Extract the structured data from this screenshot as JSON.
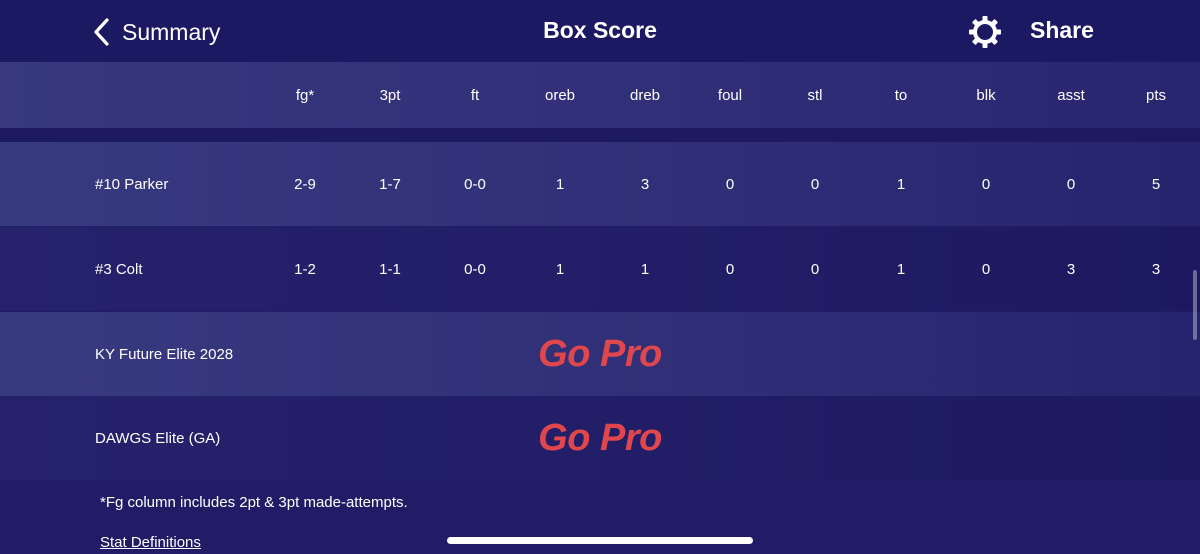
{
  "nav": {
    "back_label": "Summary",
    "title": "Box Score",
    "share_label": "Share"
  },
  "columns": [
    "fg*",
    "3pt",
    "ft",
    "oreb",
    "dreb",
    "foul",
    "stl",
    "to",
    "blk",
    "asst",
    "pts"
  ],
  "players": [
    {
      "name": "#10 Parker",
      "stats": [
        "2-9",
        "1-7",
        "0-0",
        "1",
        "3",
        "0",
        "0",
        "1",
        "0",
        "0",
        "5"
      ]
    },
    {
      "name": "#3 Colt",
      "stats": [
        "1-2",
        "1-1",
        "0-0",
        "1",
        "1",
        "0",
        "0",
        "1",
        "0",
        "3",
        "3"
      ]
    }
  ],
  "teams": [
    {
      "name": "KY Future Elite 2028",
      "upsell": "Go Pro"
    },
    {
      "name": "DAWGS Elite (GA)",
      "upsell": "Go Pro"
    }
  ],
  "footnote": "*Fg column includes 2pt & 3pt made-attempts.",
  "stat_definitions_link": "Stat Definitions",
  "colors": {
    "background": "#201d66",
    "accent_gopro": "#e0474c",
    "text": "#ffffff"
  }
}
